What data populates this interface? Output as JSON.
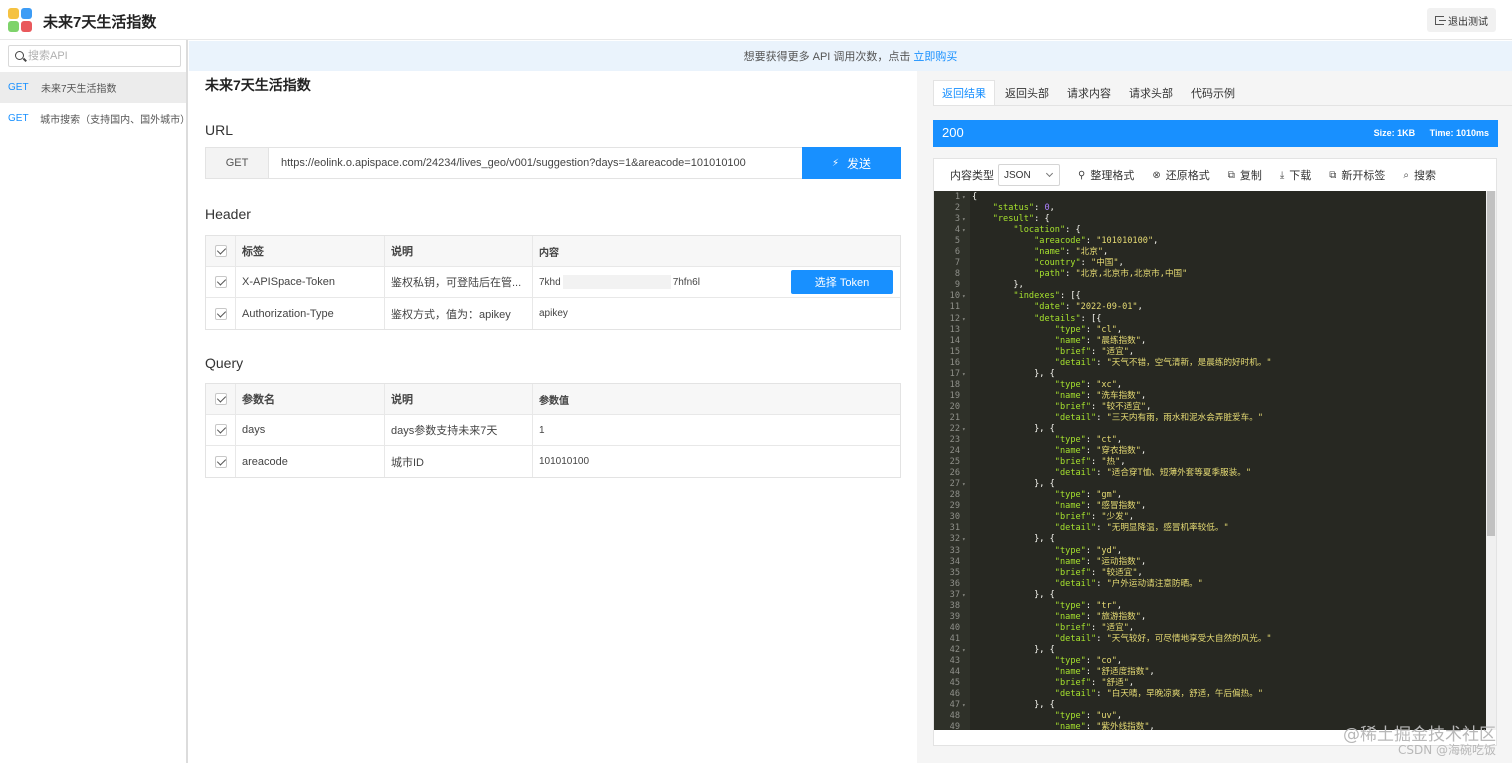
{
  "app": {
    "title": "未来7天生活指数",
    "exit_label": "退出测试",
    "logo_colors": [
      "#f5c242",
      "#3d9cf5",
      "#7ed36b",
      "#e9595c"
    ]
  },
  "sidebar": {
    "search_placeholder": "搜索API",
    "items": [
      {
        "method": "GET",
        "name": "未来7天生活指数",
        "active": true
      },
      {
        "method": "GET",
        "name": "城市搜索（支持国内、国外城市）",
        "active": false
      }
    ]
  },
  "notice": {
    "text": "想要获得更多 API 调用次数，点击",
    "link": "立即购买"
  },
  "main": {
    "api_title": "未来7天生活指数",
    "url_section": "URL",
    "method": "GET",
    "url": "https://eolink.o.apispace.com/24234/lives_geo/v001/suggestion?days=1&areacode=101010100",
    "send_label": "发送",
    "header_section": "Header",
    "header_table": {
      "columns": [
        "标签",
        "说明",
        "内容"
      ],
      "rows": [
        {
          "name": "X-APISpace-Token",
          "desc": "鉴权私钥，可登陆后在管...",
          "value_start": "7khd",
          "value_end": "7hfn6l",
          "button": "选择 Token"
        },
        {
          "name": "Authorization-Type",
          "desc": "鉴权方式，值为：apikey",
          "value": "apikey"
        }
      ]
    },
    "query_section": "Query",
    "query_table": {
      "columns": [
        "参数名",
        "说明",
        "参数值"
      ],
      "rows": [
        {
          "name": "days",
          "desc": "days参数支持未来7天",
          "value": "1"
        },
        {
          "name": "areacode",
          "desc": "城市ID",
          "value": "101010100"
        }
      ]
    }
  },
  "response": {
    "tabs": [
      "返回结果",
      "返回头部",
      "请求内容",
      "请求头部",
      "代码示例"
    ],
    "active_tab": 0,
    "status_code": "200",
    "size": "Size:  1KB",
    "time": "Time:  1010ms",
    "content_type_label": "内容类型",
    "content_type": "JSON",
    "tools": [
      {
        "icon": "brush-icon",
        "glyph": "⚲",
        "label": "整理格式"
      },
      {
        "icon": "restore-icon",
        "glyph": "⊗",
        "label": "还原格式"
      },
      {
        "icon": "copy-icon",
        "glyph": "⧉",
        "label": "复制"
      },
      {
        "icon": "download-icon",
        "glyph": "⤓",
        "label": "下载"
      },
      {
        "icon": "new-tab-icon",
        "glyph": "⧉",
        "label": "新开标签"
      },
      {
        "icon": "search-icon",
        "glyph": "⌕",
        "label": "搜索"
      }
    ],
    "code_lines": [
      "{",
      "    \"status\": 0,",
      "    \"result\": {",
      "        \"location\": {",
      "            \"areacode\": \"101010100\",",
      "            \"name\": \"北京\",",
      "            \"country\": \"中国\",",
      "            \"path\": \"北京,北京市,北京市,中国\"",
      "        },",
      "        \"indexes\": [{",
      "            \"date\": \"2022-09-01\",",
      "            \"details\": [{",
      "                \"type\": \"cl\",",
      "                \"name\": \"晨练指数\",",
      "                \"brief\": \"适宜\",",
      "                \"detail\": \"天气不错，空气清新，是晨练的好时机。\"",
      "            }, {",
      "                \"type\": \"xc\",",
      "                \"name\": \"洗车指数\",",
      "                \"brief\": \"较不适宜\",",
      "                \"detail\": \"三天内有雨，雨水和泥水会弄脏爱车。\"",
      "            }, {",
      "                \"type\": \"ct\",",
      "                \"name\": \"穿衣指数\",",
      "                \"brief\": \"热\",",
      "                \"detail\": \"适合穿T恤、短薄外套等夏季服装。\"",
      "            }, {",
      "                \"type\": \"gm\",",
      "                \"name\": \"感冒指数\",",
      "                \"brief\": \"少发\",",
      "                \"detail\": \"无明显降温，感冒机率较低。\"",
      "            }, {",
      "                \"type\": \"yd\",",
      "                \"name\": \"运动指数\",",
      "                \"brief\": \"较适宜\",",
      "                \"detail\": \"户外运动请注意防晒。\"",
      "            }, {",
      "                \"type\": \"tr\",",
      "                \"name\": \"旅游指数\",",
      "                \"brief\": \"适宜\",",
      "                \"detail\": \"天气较好，可尽情地享受大自然的风光。\"",
      "            }, {",
      "                \"type\": \"co\",",
      "                \"name\": \"舒适度指数\",",
      "                \"brief\": \"舒适\",",
      "                \"detail\": \"白天晴，早晚凉爽，舒适，午后偏热。\"",
      "            }, {",
      "                \"type\": \"uv\",",
      "                \"name\": \"紫外线指数\","
    ],
    "fold_lines": [
      1,
      3,
      4,
      10,
      12,
      17,
      22,
      27,
      32,
      37,
      42,
      47
    ]
  },
  "watermarks": {
    "line1": "@稀土掘金技术社区",
    "line2": "CSDN @海碗吃饭"
  }
}
